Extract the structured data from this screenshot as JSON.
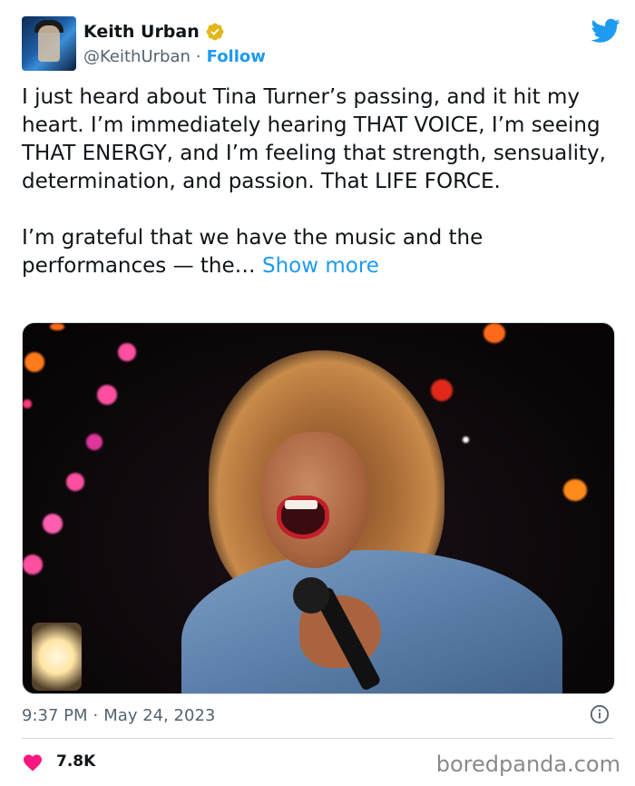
{
  "author": {
    "name": "Keith Urban",
    "handle": "@KeithUrban",
    "separator": "·",
    "follow_label": "Follow"
  },
  "tweet": {
    "text": "I just heard about Tina Turner’s passing, and it hit my heart. I’m immediately hearing THAT VOICE, I’m seeing THAT ENERGY, and I’m feeling that strength, sensuality, determination, and passion. That LIFE FORCE.\n\nI’m grateful that we have the music and the performances — the… ",
    "show_more_label": "Show more"
  },
  "meta": {
    "time": "9:37 PM",
    "separator": "·",
    "date": "May 24, 2023"
  },
  "engagement": {
    "likes": "7.8K"
  },
  "watermark": "boredpanda.com",
  "colors": {
    "accent": "#1d9bf0",
    "heart": "#f91880",
    "verified": "#e2b719"
  },
  "icons": {
    "verified": "verified-badge-icon",
    "brand": "twitter-bird-icon",
    "info": "info-icon",
    "like": "heart-icon"
  }
}
